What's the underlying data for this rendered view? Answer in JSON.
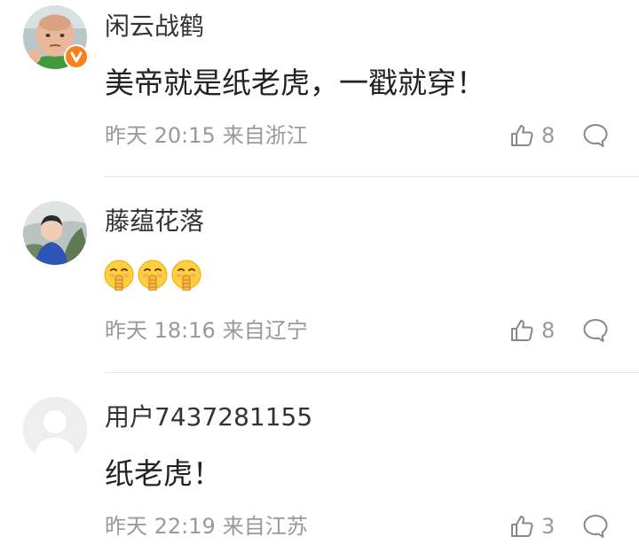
{
  "comments": [
    {
      "username": "闲云战鹤",
      "content": "美帝就是纸老虎，一戳就穿！",
      "time": "昨天 20:15",
      "location": "来自浙江",
      "likes": "8",
      "verified": true
    },
    {
      "username": "藤蕴花落",
      "content": "",
      "emojis": [
        "shush-emoji",
        "shush-emoji",
        "shush-emoji"
      ],
      "time": "昨天 18:16",
      "location": "来自辽宁",
      "likes": "8",
      "verified": false
    },
    {
      "username": "用户7437281155",
      "content": "纸老虎！",
      "time": "昨天 22:19",
      "location": "来自江苏",
      "likes": "3",
      "verified": false
    }
  ],
  "colors": {
    "username": "#333333",
    "content": "#222222",
    "meta": "#999999",
    "verified_badge": "#f7811f",
    "divider": "#e6e6e6"
  }
}
